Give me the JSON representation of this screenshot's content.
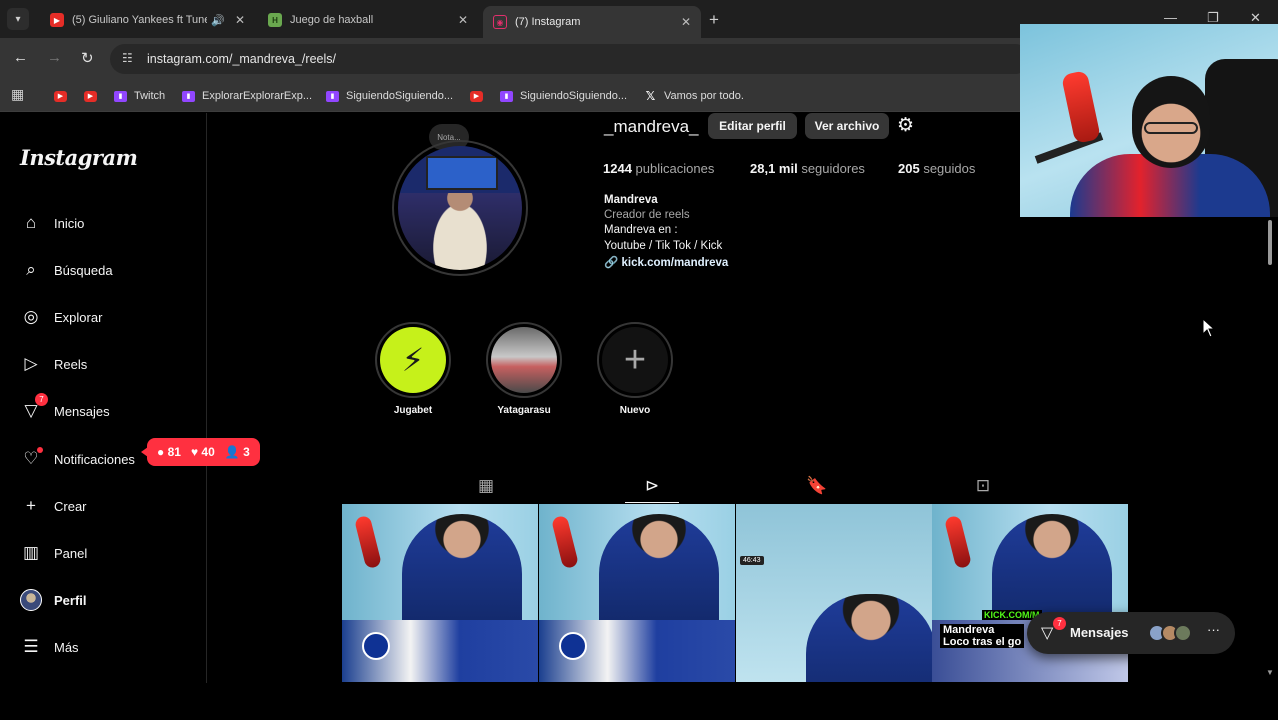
{
  "browser": {
    "tabs": [
      {
        "title": "(5) Giuliano Yankees ft Tune",
        "favicon": "youtube-icon",
        "color": "#e52d27"
      },
      {
        "title": "Juego de haxball",
        "favicon": "haxball-icon",
        "color": "#5a8f3a"
      },
      {
        "title": "(7) Instagram",
        "favicon": "instagram-icon",
        "color": "#e1306c"
      }
    ],
    "url": "instagram.com/_mandreva_/reels/",
    "bookmarks": [
      {
        "label": "",
        "type": "yt"
      },
      {
        "label": "",
        "type": "yt"
      },
      {
        "label": "Twitch",
        "type": "tw"
      },
      {
        "label": "ExplorarExplorarExp...",
        "type": "tw"
      },
      {
        "label": "SiguiendoSiguiendo...",
        "type": "tw"
      },
      {
        "label": "",
        "type": "yt"
      },
      {
        "label": "SiguiendoSiguiendo...",
        "type": "tw"
      },
      {
        "label": "Vamos por todo.",
        "type": "x"
      }
    ]
  },
  "sidebar": {
    "logo": "Instagram",
    "items": [
      {
        "label": "Inicio",
        "icon": "home-icon"
      },
      {
        "label": "Búsqueda",
        "icon": "search-icon"
      },
      {
        "label": "Explorar",
        "icon": "compass-icon"
      },
      {
        "label": "Reels",
        "icon": "reels-icon"
      },
      {
        "label": "Mensajes",
        "icon": "messenger-icon",
        "badge": "7"
      },
      {
        "label": "Notificaciones",
        "icon": "heart-icon"
      },
      {
        "label": "Crear",
        "icon": "plus-icon"
      },
      {
        "label": "Panel",
        "icon": "chart-icon"
      },
      {
        "label": "Perfil",
        "icon": "avatar"
      },
      {
        "label": "Más",
        "icon": "menu-icon"
      }
    ],
    "notifications_pill": {
      "comments": "81",
      "likes": "40",
      "follows": "3"
    }
  },
  "profile": {
    "note": "Nota...",
    "username": "_mandreva_",
    "edit_button": "Editar perfil",
    "archive_button": "Ver archivo",
    "stats": [
      {
        "value": "1244",
        "label": "publicaciones"
      },
      {
        "value": "28,1 mil",
        "label": "seguidores"
      },
      {
        "value": "205",
        "label": "seguidos"
      }
    ],
    "bio_name": "Mandreva",
    "bio_category": "Creador de reels",
    "bio_lines": [
      "Mandreva en :",
      "Youtube / Tik Tok / Kick"
    ],
    "bio_link": "kick.com/mandreva"
  },
  "highlights": [
    {
      "label": "Jugabet"
    },
    {
      "label": "Yatagarasu"
    },
    {
      "label": "Nuevo"
    }
  ],
  "tabs": [
    "posts-grid-icon",
    "reels-icon",
    "saved-icon",
    "tagged-icon"
  ],
  "reels": [
    {
      "caption": ""
    },
    {
      "caption": ""
    },
    {
      "timestamp": "46:43"
    },
    {
      "caption": "Mandreva\nLoco tras el go",
      "kick": "KICK.COM/M"
    }
  ],
  "messages_pill": {
    "label": "Mensajes",
    "badge": "7"
  },
  "colors": {
    "accent_red": "#ff3040",
    "background": "#000000",
    "secondary_button": "#363636"
  }
}
